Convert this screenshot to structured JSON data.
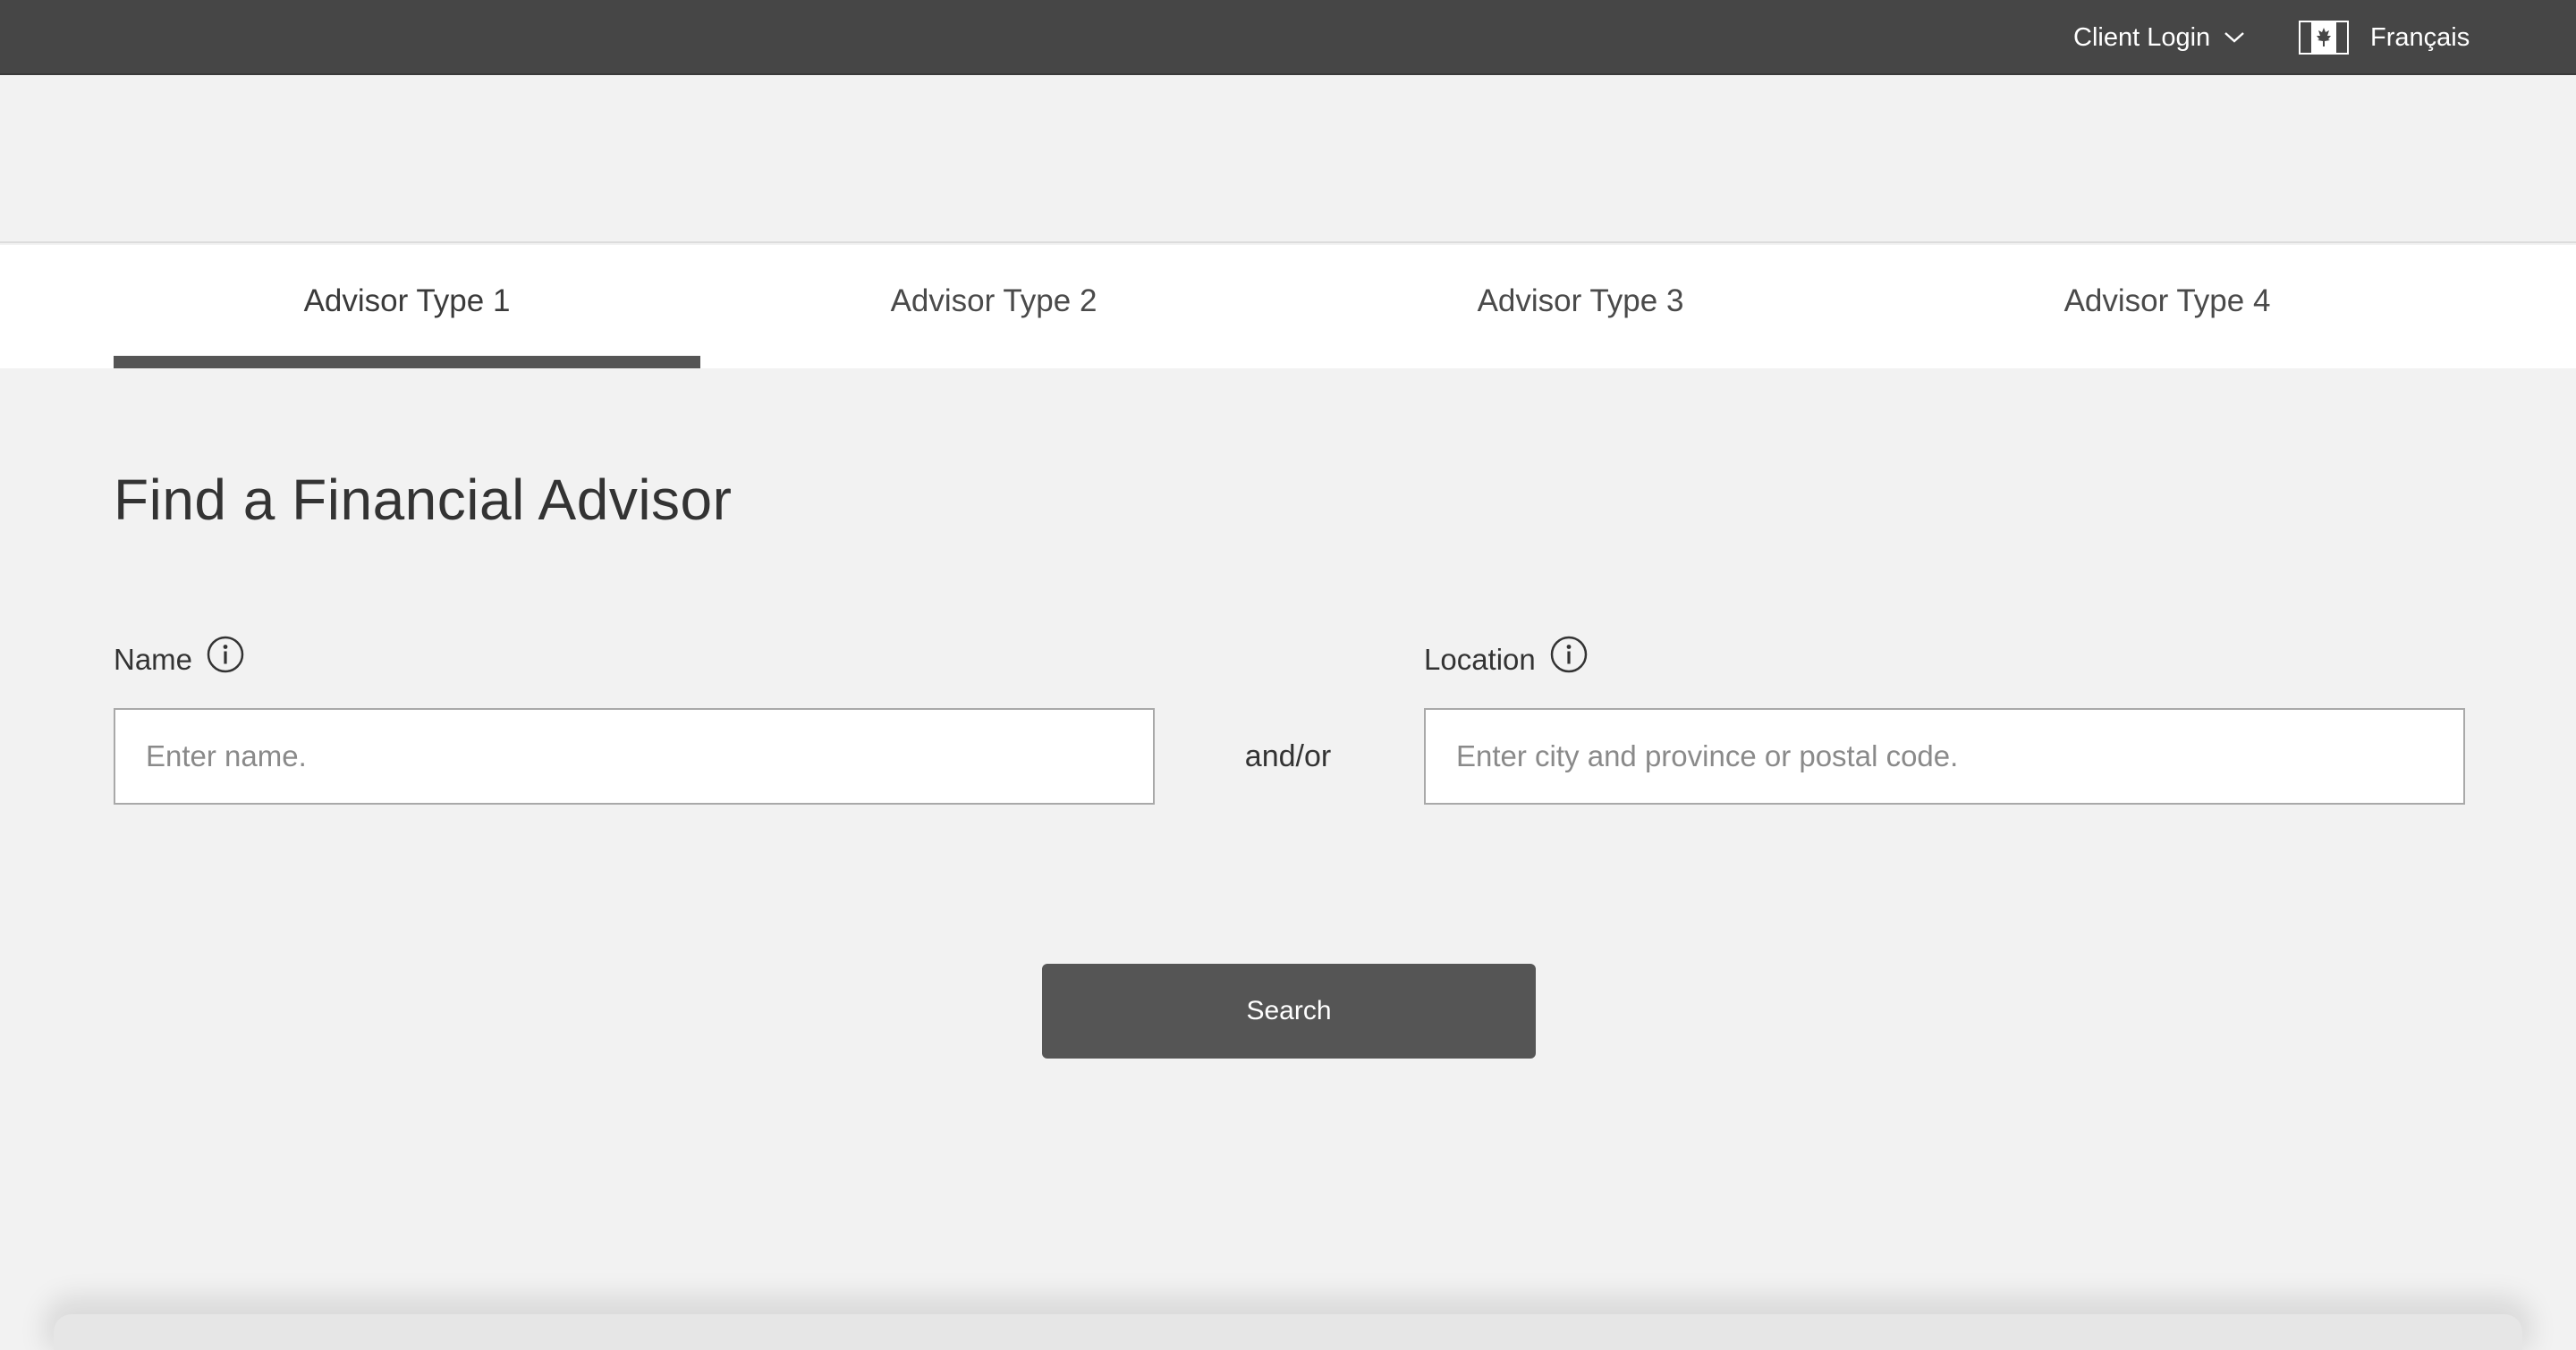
{
  "topbar": {
    "client_login_label": "Client Login",
    "language_label": "Français",
    "flag_icon": "canada-flag-icon",
    "chevron_icon": "chevron-down-icon",
    "background_color": "#464646"
  },
  "tabs": [
    {
      "label": "Advisor Type 1",
      "active": true
    },
    {
      "label": "Advisor Type 2",
      "active": false
    },
    {
      "label": "Advisor Type 3",
      "active": false
    },
    {
      "label": "Advisor Type 4",
      "active": false
    }
  ],
  "main": {
    "title": "Find a Financial Advisor",
    "name_field": {
      "label": "Name",
      "placeholder": "Enter name.",
      "value": "",
      "icon": "info-icon"
    },
    "separator": "and/or",
    "location_field": {
      "label": "Location",
      "placeholder": "Enter city and province or postal code.",
      "value": "",
      "icon": "info-icon"
    },
    "search_button_label": "Search"
  },
  "colors": {
    "page_background": "#f2f2f2",
    "tab_bar_background": "#ffffff",
    "active_tab_indicator": "#555555",
    "button_background": "#555555"
  }
}
